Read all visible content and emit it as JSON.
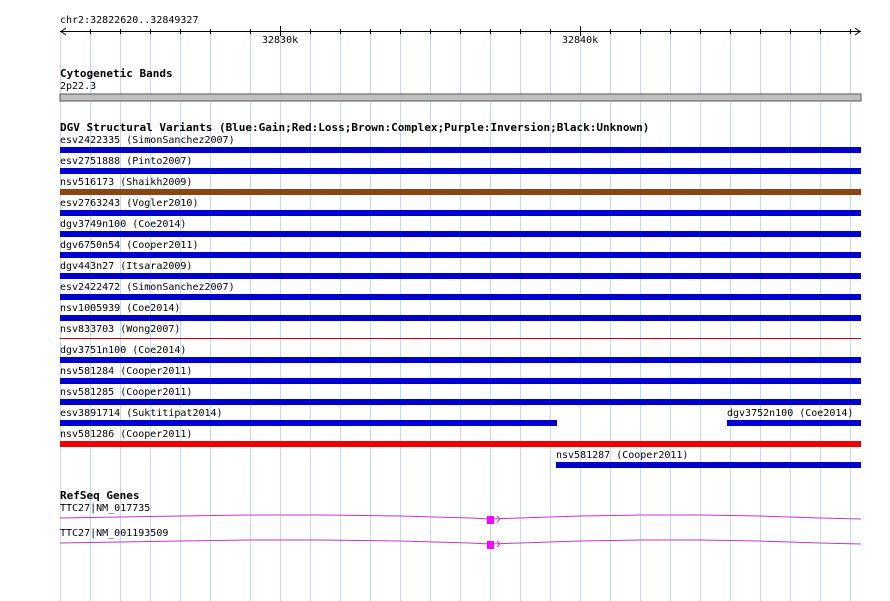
{
  "ruler": {
    "region": "chr2:32822620..32849327",
    "tick_labels": [
      "32830k",
      "32840k"
    ]
  },
  "cytoband": {
    "title": "Cytogenetic Bands",
    "band": "2p22.3"
  },
  "dgv": {
    "title": "DGV Structural Variants (Blue:Gain;Red:Loss;Brown:Complex;Purple:Inversion;Black:Unknown)",
    "variants": [
      {
        "label": "esv2422335 (SimonSanchez2007)",
        "color": "#0000cc"
      },
      {
        "label": "esv2751888 (Pinto2007)",
        "color": "#0000cc"
      },
      {
        "label": "nsv516173 (Shaikh2009)",
        "color": "#8b4513"
      },
      {
        "label": "esv2763243 (Vogler2010)",
        "color": "#0000cc"
      },
      {
        "label": "dgv3749n100 (Coe2014)",
        "color": "#0000cc"
      },
      {
        "label": "dgv6750n54 (Cooper2011)",
        "color": "#0000cc"
      },
      {
        "label": "dgv443n27 (Itsara2009)",
        "color": "#0000cc"
      },
      {
        "label": "esv2422472 (SimonSanchez2007)",
        "color": "#0000cc"
      },
      {
        "label": "nsv1005939 (Coe2014)",
        "color": "#0000cc"
      },
      {
        "label": "nsv833703 (Wong2007)",
        "color": "#cc0000"
      },
      {
        "label": "dgv3751n100 (Coe2014)",
        "color": "#0000cc"
      },
      {
        "label": "nsv581284 (Cooper2011)",
        "color": "#0000cc"
      },
      {
        "label": "nsv581285 (Cooper2011)",
        "color": "#0000cc"
      },
      {
        "label": "esv3891714 (Suktitipat2014)",
        "color": "#0000cc"
      },
      {
        "label": "dgv3752n100 (Coe2014)",
        "color": "#0000cc"
      },
      {
        "label": "nsv581286 (Cooper2011)",
        "color": "#ee0000"
      },
      {
        "label": "nsv581287 (Cooper2011)",
        "color": "#0000cc"
      }
    ]
  },
  "refseq": {
    "title": "RefSeq Genes",
    "genes": [
      {
        "label": "TTC27|NM_017735",
        "color": "#cc33cc",
        "exon_color": "#ff00ff"
      },
      {
        "label": "TTC27|NM_001193509",
        "color": "#cc33cc",
        "exon_color": "#ff00ff"
      }
    ]
  }
}
